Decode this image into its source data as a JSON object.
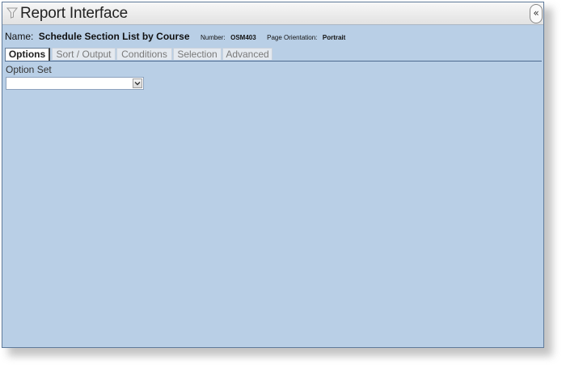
{
  "window": {
    "title": "Report Interface",
    "collapse_label": "«"
  },
  "report": {
    "name_label": "Name:",
    "name_value": "Schedule Section List by Course",
    "number_label": "Number:",
    "number_value": "OSM403",
    "orientation_label": "Page Orientation:",
    "orientation_value": "Portrait"
  },
  "tabs": [
    {
      "label": "Options",
      "active": true
    },
    {
      "label": "Sort / Output",
      "active": false
    },
    {
      "label": "Conditions",
      "active": false
    },
    {
      "label": "Selection",
      "active": false
    },
    {
      "label": "Advanced",
      "active": false
    }
  ],
  "options": {
    "option_set_label": "Option Set",
    "option_set_value": ""
  },
  "colors": {
    "panel_bg": "#b9cfe6",
    "title_bg": "#ececec"
  },
  "icons": {
    "title_icon": "funnel-icon",
    "collapse_icon": "double-chevron-left-icon",
    "dropdown_icon": "chevron-down-icon"
  }
}
